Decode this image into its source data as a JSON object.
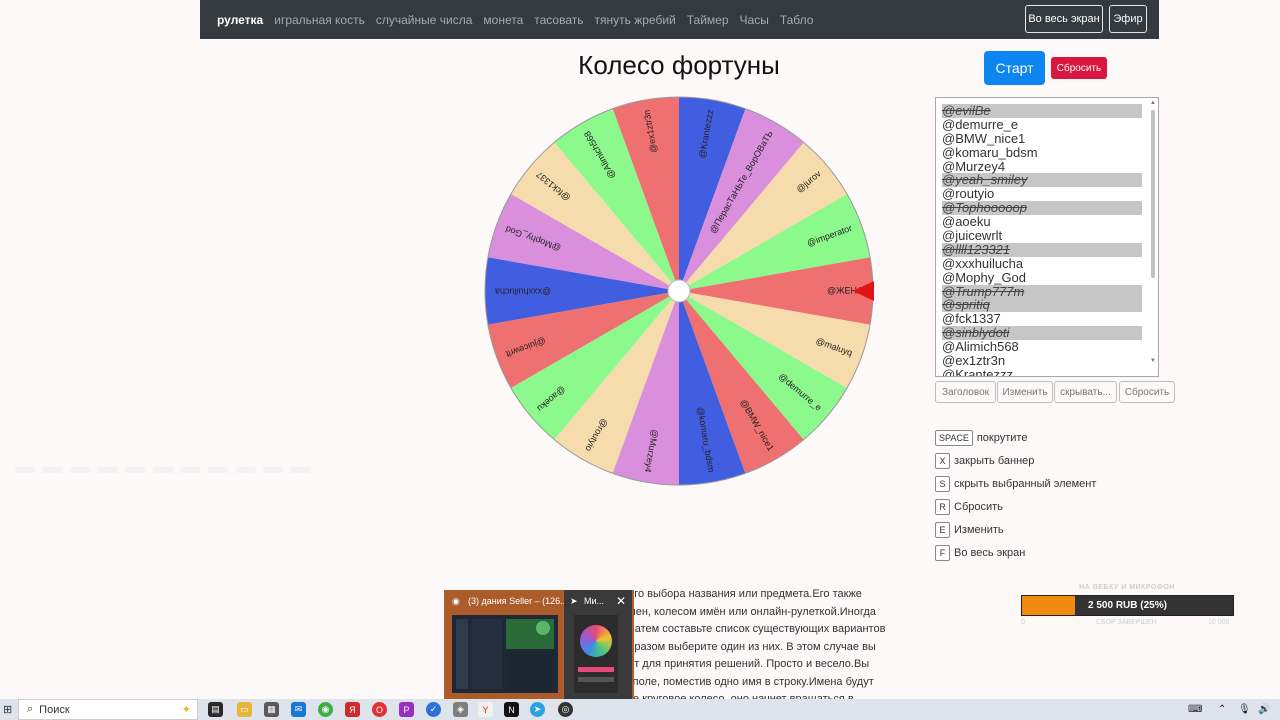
{
  "nav": {
    "links": [
      "рулетка",
      "игральная кость",
      "случайные числа",
      "монета",
      "тасовать",
      "тянуть жребий",
      "Таймер",
      "Часы",
      "Табло"
    ],
    "fullscreen_label": "Во весь экран",
    "live_label": "Эфир"
  },
  "title": "Колесо фортуны",
  "controls": {
    "start_label": "Старт",
    "reset_label": "Сбросить"
  },
  "wheel": {
    "colors": [
      "#ef7070",
      "#8cf98c",
      "#f6dcac",
      "#da8fdd",
      "#425ee0"
    ],
    "pointer_color": "#e01414",
    "segments": [
      "@ЖЕНА",
      "@imperator",
      "@jurov",
      "@ПерасТаНЬТе_ВорОВаТЬ",
      "@Krantezzz",
      "@ex1ztr3n",
      "@Alimich568",
      "@fck1337",
      "@Mophy_God",
      "@xxxhuilucha",
      "@juicewrlt",
      "@aoeku",
      "@routyio",
      "@Murzey4",
      "@komaru_bdsm",
      "@BMW_nice1",
      "@demurre_e",
      "@maluyq"
    ]
  },
  "names": [
    {
      "text": "@evilBe",
      "hidden": true
    },
    {
      "text": "@demurre_e",
      "hidden": false
    },
    {
      "text": "@BMW_nice1",
      "hidden": false
    },
    {
      "text": "@komaru_bdsm",
      "hidden": false
    },
    {
      "text": "@Murzey4",
      "hidden": false
    },
    {
      "text": "@yeah_smiley",
      "hidden": true
    },
    {
      "text": "@routyio",
      "hidden": false
    },
    {
      "text": "@Tophooooop",
      "hidden": true
    },
    {
      "text": "@aoeku",
      "hidden": false
    },
    {
      "text": "@juicewrlt",
      "hidden": false
    },
    {
      "text": "@llll123321",
      "hidden": true
    },
    {
      "text": "@xxxhuilucha",
      "hidden": false
    },
    {
      "text": "@Mophy_God",
      "hidden": false
    },
    {
      "text": "@Trump777m",
      "hidden": true
    },
    {
      "text": "@spritiq",
      "hidden": true
    },
    {
      "text": "@fck1337",
      "hidden": false
    },
    {
      "text": "@sinblydoti",
      "hidden": true
    },
    {
      "text": "@Alimich568",
      "hidden": false
    },
    {
      "text": "@ex1ztr3n",
      "hidden": false
    },
    {
      "text": "@Krantezzz",
      "hidden": false
    }
  ],
  "list_buttons": [
    "Заголовок",
    "Изменить",
    "скрывать...",
    "Сбросить"
  ],
  "shortcuts": [
    {
      "key": "SPACE",
      "label": "покрутите"
    },
    {
      "key": "X",
      "label": "закрыть баннер"
    },
    {
      "key": "S",
      "label": "скрыть выбранный элемент"
    },
    {
      "key": "R",
      "label": "Сбросить"
    },
    {
      "key": "E",
      "label": "Изменить"
    },
    {
      "key": "F",
      "label": "Во весь экран"
    }
  ],
  "description": [
    "ного выбора названия или предмета.Его также",
    "имен, колесом имён или онлайн-рулеткой.Иногда",
    ". Затем составьте список существующих вариантов",
    "образом выберите один из них. В этом случае вы",
    "ент для принятия решений. Просто и весело.Вы",
    "м поле, поместив одно имя в строку.Имена будут",
    "ите круговое колесо, оно начнет вращаться в"
  ],
  "donation": {
    "title": "НА ВЕБКУ И МИКРОФОН",
    "amount": "2 500 RUB (25%)",
    "progress": 0.25,
    "min": "0",
    "sub": "СБОР ЗАВЕРШЕН",
    "max": "10 000",
    "fill_color": "#f18b10"
  },
  "preview": {
    "item1_title": "(3) дания Seller – (126...",
    "item2_title": "Ми..."
  },
  "taskbar": {
    "search_placeholder": "Поиск"
  }
}
